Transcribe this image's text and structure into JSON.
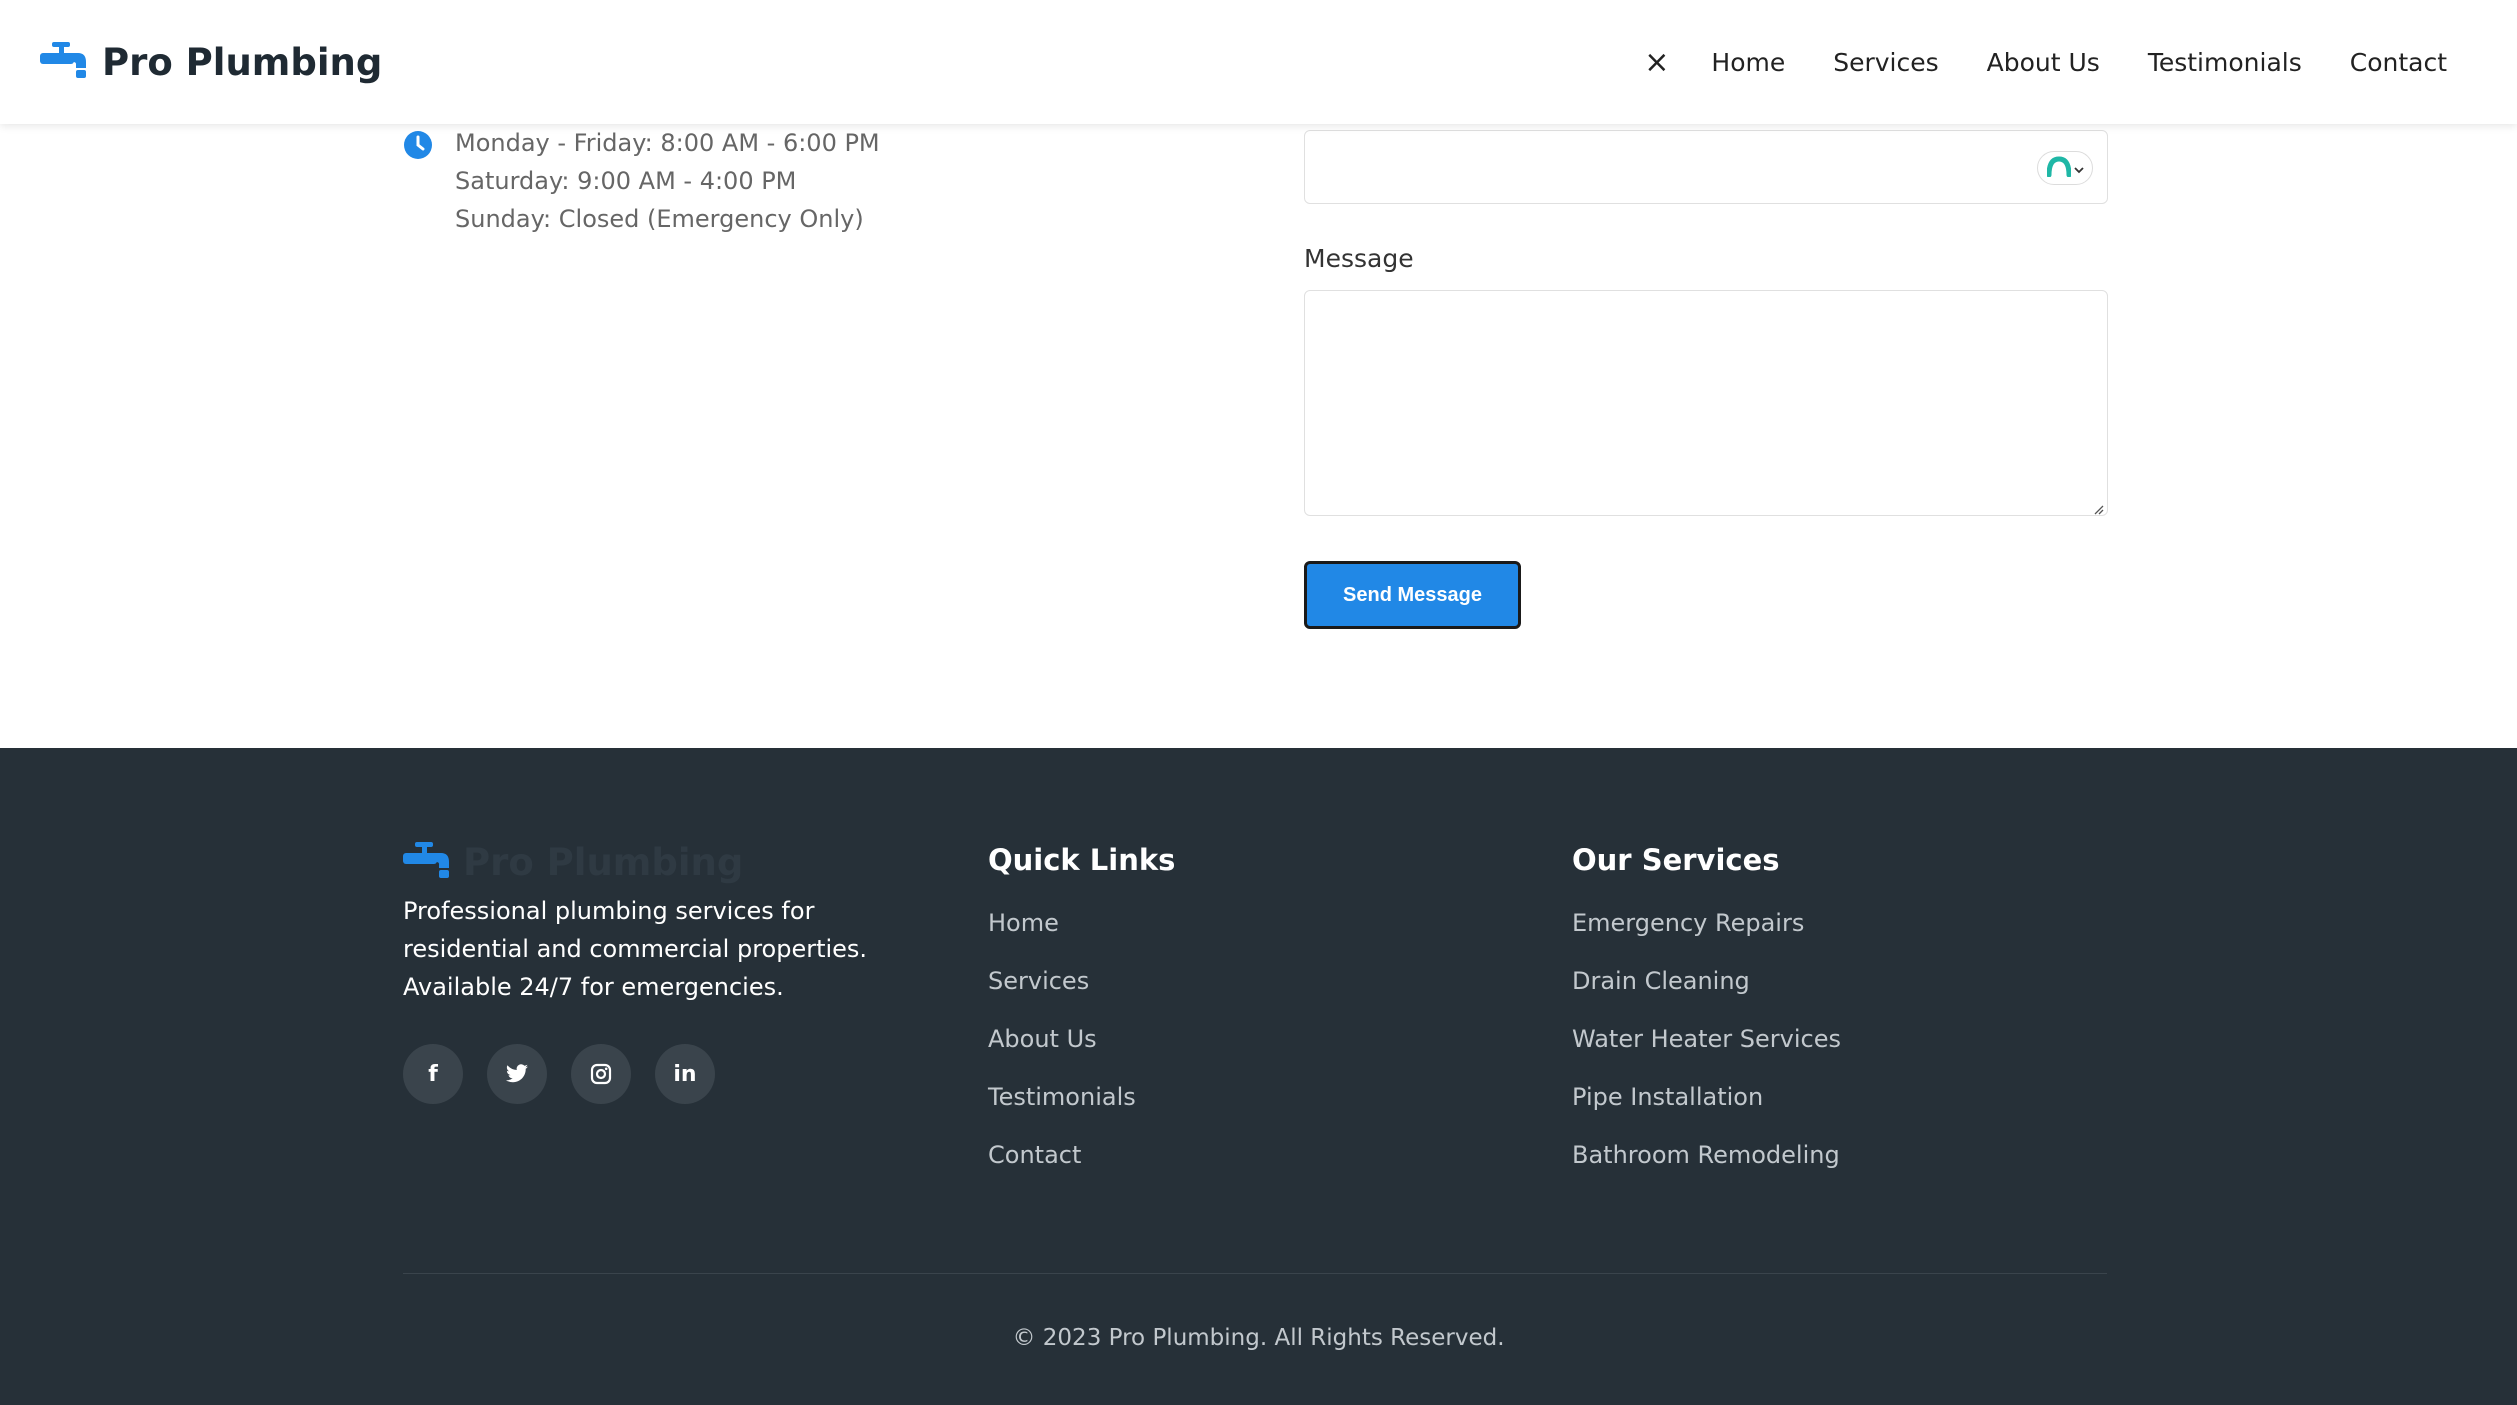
{
  "brand": {
    "name": "Pro Plumbing",
    "icon": "faucet-icon",
    "color": "#2188e6"
  },
  "nav": {
    "close_icon": "×",
    "items": [
      "Home",
      "Services",
      "About Us",
      "Testimonials",
      "Contact"
    ]
  },
  "hours": {
    "icon": "clock-icon",
    "lines": [
      "Monday - Friday: 8:00 AM - 6:00 PM",
      "Saturday: 9:00 AM - 4:00 PM",
      "Sunday: Closed (Emergency Only)"
    ]
  },
  "form": {
    "select_value": "",
    "message_label": "Message",
    "message_value": "",
    "submit_label": "Send Message",
    "accent_color": "#2188e6"
  },
  "footer": {
    "brand_name": "Pro Plumbing",
    "about": "Professional plumbing services for residential and commercial properties. Available 24/7 for emergencies.",
    "socials": [
      {
        "name": "facebook-icon",
        "glyph": "f"
      },
      {
        "name": "twitter-icon",
        "glyph": ""
      },
      {
        "name": "instagram-icon",
        "glyph": ""
      },
      {
        "name": "linkedin-icon",
        "glyph": "in"
      }
    ],
    "quick_links_heading": "Quick Links",
    "quick_links": [
      "Home",
      "Services",
      "About Us",
      "Testimonials",
      "Contact"
    ],
    "services_heading": "Our Services",
    "services": [
      "Emergency Repairs",
      "Drain Cleaning",
      "Water Heater Services",
      "Pipe Installation",
      "Bathroom Remodeling"
    ],
    "copyright": "© 2023 Pro Plumbing. All Rights Reserved.",
    "background": "#263038"
  }
}
